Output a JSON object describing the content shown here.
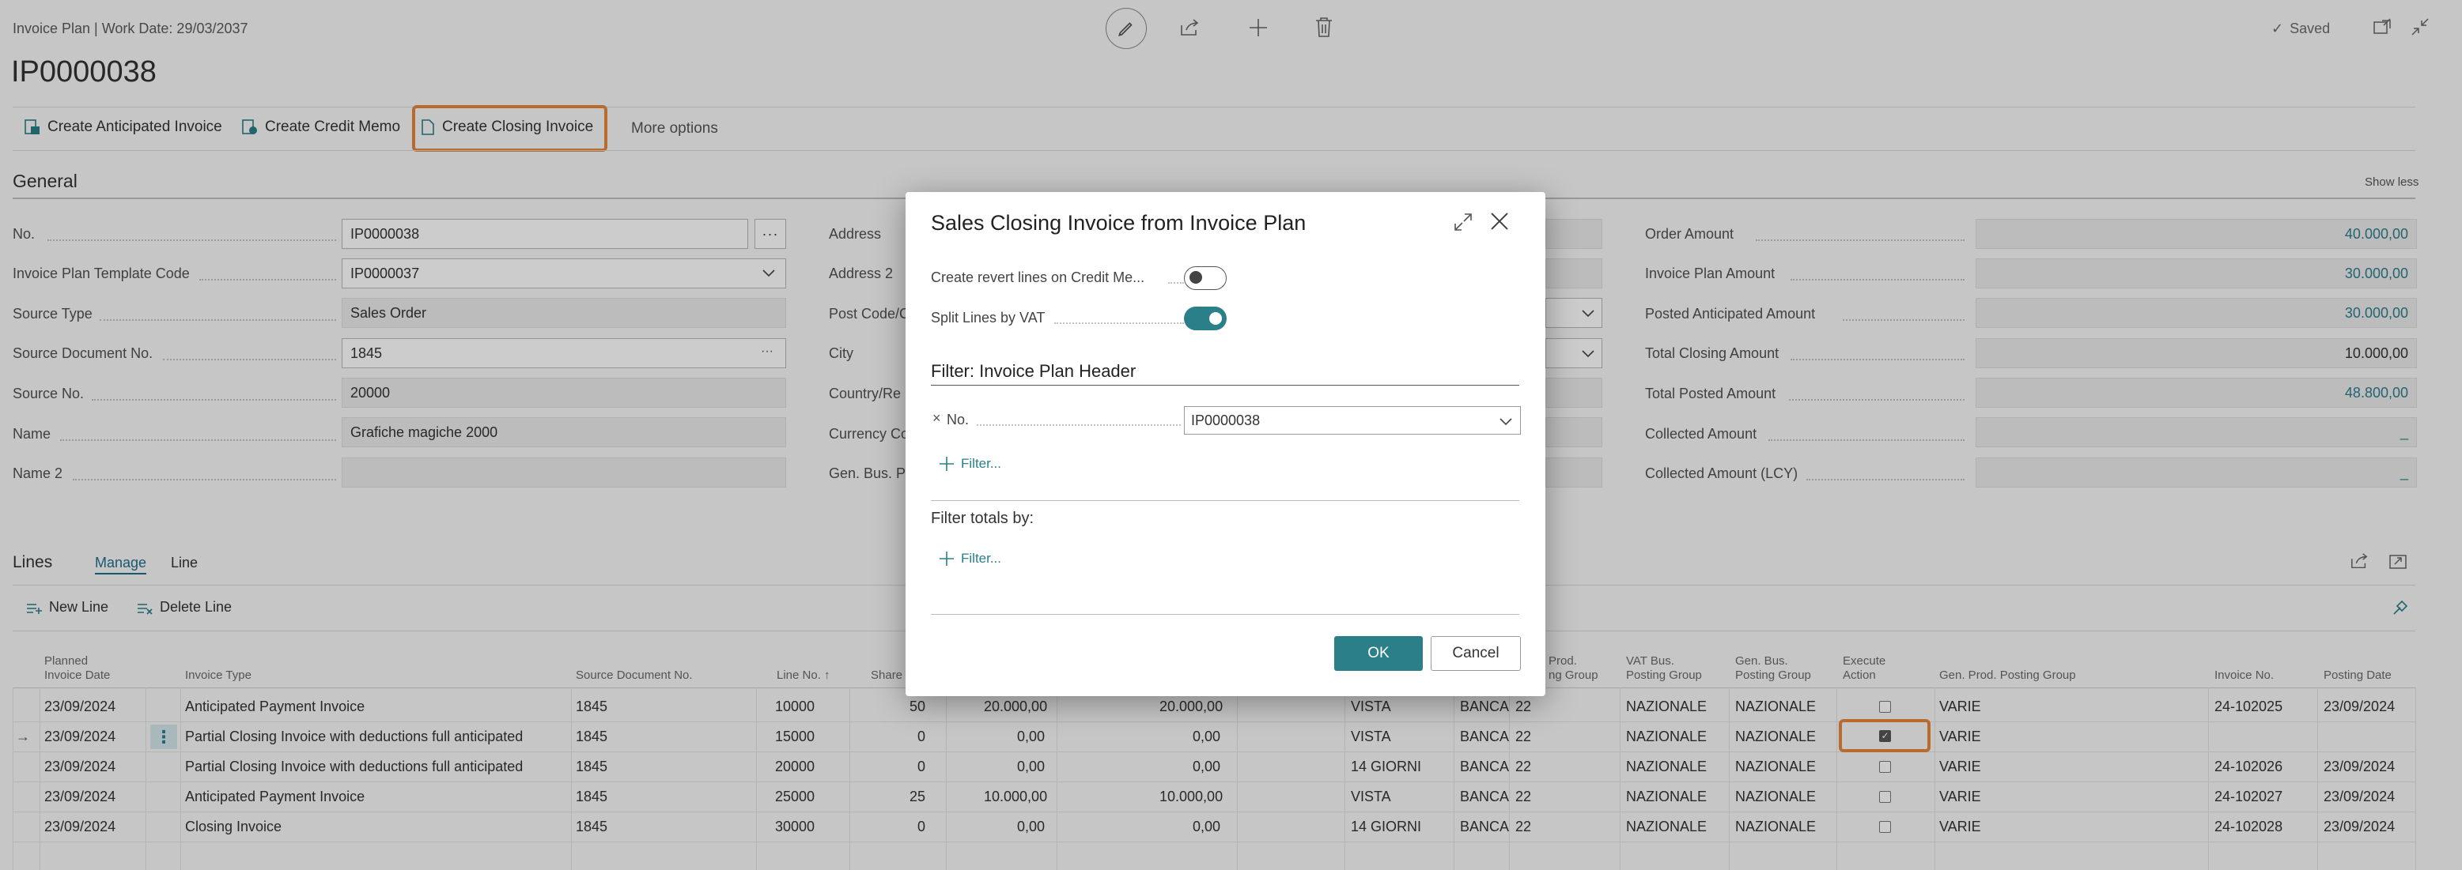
{
  "header": {
    "title": "Invoice Plan | Work Date: 29/03/2037",
    "record_no": "IP0000038",
    "saved_status": "Saved",
    "check_mark": "✓"
  },
  "actions": {
    "create_anticipated": "Create Anticipated Invoice",
    "create_credit_memo": "Create Credit Memo",
    "create_closing": "Create Closing Invoice",
    "more_options": "More options"
  },
  "general": {
    "title": "General",
    "show_less": "Show less",
    "left_fields": [
      {
        "label": "No.",
        "value": "IP0000038"
      },
      {
        "label": "Invoice Plan Template Code",
        "value": "IP0000037"
      },
      {
        "label": "Source Type",
        "value": "Sales Order"
      },
      {
        "label": "Source Document No.",
        "value": "1845"
      },
      {
        "label": "Source No.",
        "value": "20000"
      },
      {
        "label": "Name",
        "value": "Grafiche magiche 2000"
      },
      {
        "label": "Name 2",
        "value": ""
      }
    ],
    "mid_labels": [
      "Address",
      "Address 2",
      "Post Code/C",
      "City",
      "Country/Re",
      "Currency Co",
      "Gen. Bus. Po"
    ],
    "right_fields": [
      {
        "label": "Order Amount",
        "value": "40.000,00"
      },
      {
        "label": "Invoice Plan Amount",
        "value": "30.000,00"
      },
      {
        "label": "Posted Anticipated Amount",
        "value": "30.000,00"
      },
      {
        "label": "Total Closing Amount",
        "value": "10.000,00"
      },
      {
        "label": "Total Posted Amount",
        "value": "48.800,00"
      },
      {
        "label": "Collected Amount",
        "value": "_"
      },
      {
        "label": "Collected Amount (LCY)",
        "value": "_"
      }
    ]
  },
  "lines": {
    "title": "Lines",
    "tab_manage": "Manage",
    "tab_line": "Line",
    "new_line": "New Line",
    "delete_line": "Delete Line",
    "headers": {
      "planned_date": [
        "Planned",
        "Invoice Date"
      ],
      "invoice_type": "Invoice Type",
      "source_doc": "Source Document No.",
      "line_no": "Line No. ↑",
      "share": "Share",
      "prod_posting": [
        "Prod.",
        "ng Group"
      ],
      "vat_bus": [
        "VAT Bus.",
        "Posting Group"
      ],
      "gen_bus": [
        "Gen. Bus.",
        "Posting Group"
      ],
      "execute": [
        "Execute",
        "Action"
      ],
      "gen_prod": "Gen. Prod. Posting Group",
      "invoice_no": "Invoice No.",
      "posting_date": "Posting Date"
    },
    "rows": [
      {
        "date": "23/09/2024",
        "type": "Anticipated Payment Invoice",
        "src": "1845",
        "line": "10000",
        "share": "50",
        "amt1": "20.000,00",
        "amt2": "20.000,00",
        "terms": "VISTA",
        "pay": "BANCA",
        "prod": "22",
        "vat": "NAZIONALE",
        "gen": "NAZIONALE",
        "exec": false,
        "genprod": "VARIE",
        "inv": "24-102025",
        "post": "23/09/2024"
      },
      {
        "date": "23/09/2024",
        "type": "Partial Closing Invoice with deductions full anticipated",
        "src": "1845",
        "line": "15000",
        "share": "0",
        "amt1": "0,00",
        "amt2": "0,00",
        "terms": "VISTA",
        "pay": "BANCA",
        "prod": "22",
        "vat": "NAZIONALE",
        "gen": "NAZIONALE",
        "exec": true,
        "genprod": "VARIE",
        "inv": "",
        "post": ""
      },
      {
        "date": "23/09/2024",
        "type": "Partial Closing Invoice with deductions full anticipated",
        "src": "1845",
        "line": "20000",
        "share": "0",
        "amt1": "0,00",
        "amt2": "0,00",
        "terms": "14 GIORNI",
        "pay": "BANCA",
        "prod": "22",
        "vat": "NAZIONALE",
        "gen": "NAZIONALE",
        "exec": false,
        "genprod": "VARIE",
        "inv": "24-102026",
        "post": "23/09/2024"
      },
      {
        "date": "23/09/2024",
        "type": "Anticipated Payment Invoice",
        "src": "1845",
        "line": "25000",
        "share": "25",
        "amt1": "10.000,00",
        "amt2": "10.000,00",
        "terms": "VISTA",
        "pay": "BANCA",
        "prod": "22",
        "vat": "NAZIONALE",
        "gen": "NAZIONALE",
        "exec": false,
        "genprod": "VARIE",
        "inv": "24-102027",
        "post": "23/09/2024"
      },
      {
        "date": "23/09/2024",
        "type": "Closing Invoice",
        "src": "1845",
        "line": "30000",
        "share": "0",
        "amt1": "0,00",
        "amt2": "0,00",
        "terms": "14 GIORNI",
        "pay": "BANCA",
        "prod": "22",
        "vat": "NAZIONALE",
        "gen": "NAZIONALE",
        "exec": false,
        "genprod": "VARIE",
        "inv": "24-102028",
        "post": "23/09/2024"
      }
    ]
  },
  "dialog": {
    "title": "Sales Closing Invoice from Invoice Plan",
    "opt1_label": "Create revert lines on Credit Me...",
    "opt1_on": false,
    "opt2_label": "Split Lines by VAT",
    "opt2_on": true,
    "filter_header": "Filter: Invoice Plan Header",
    "filter_field": "No.",
    "filter_remove": "×",
    "filter_value": "IP0000038",
    "add_filter": "Filter...",
    "totals_label": "Filter totals by:",
    "add_totals_filter": "Filter...",
    "ok": "OK",
    "cancel": "Cancel"
  },
  "colors": {
    "accent": "#2a7f88",
    "highlight": "#e5863b",
    "link": "#1f6f8b"
  }
}
